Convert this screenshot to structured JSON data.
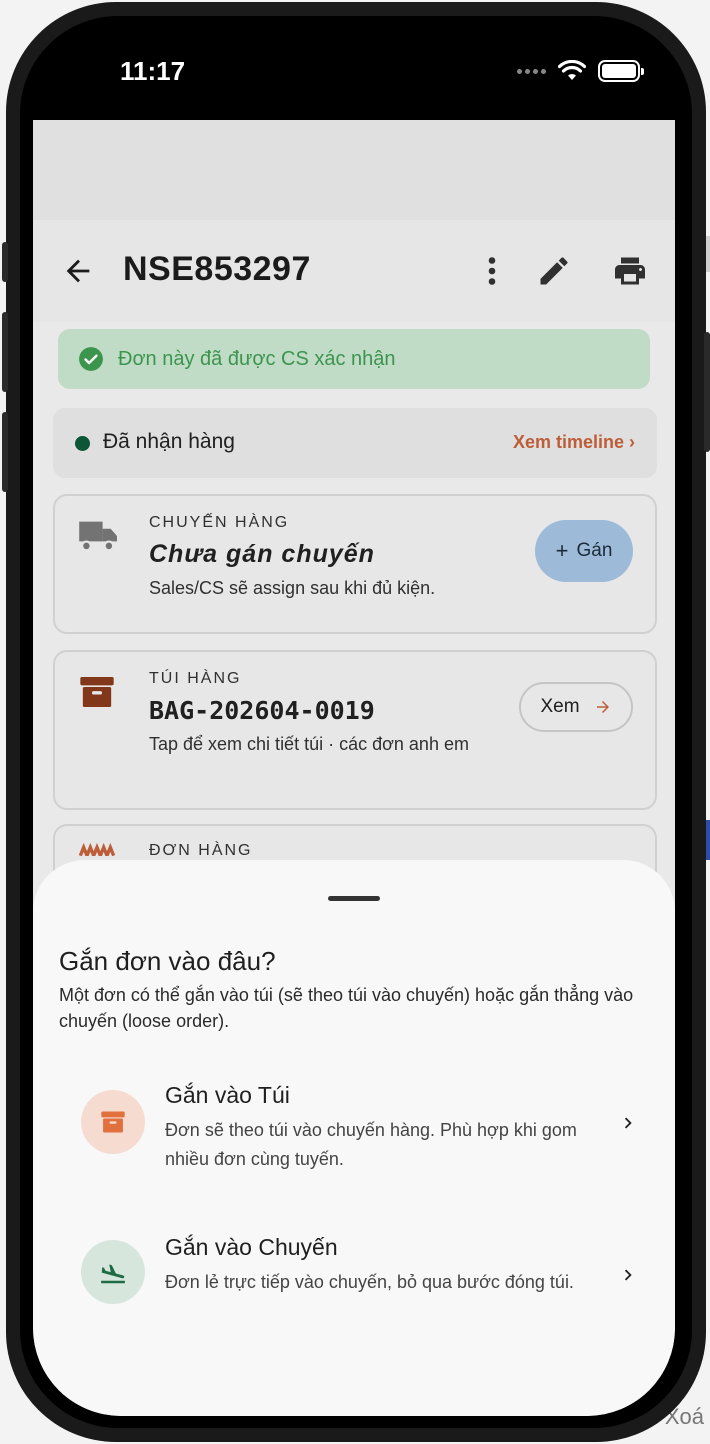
{
  "status_bar": {
    "time": "11:17"
  },
  "app_bar": {
    "order_code": "NSE853297"
  },
  "banner": {
    "text": "Đơn này đã được CS xác nhận"
  },
  "order_status": {
    "label": "Đã nhận hàng",
    "timeline_link": "Xem timeline ›"
  },
  "shipment_card": {
    "eyebrow": "CHUYẾN HÀNG",
    "value": "Chưa gán chuyến",
    "note": "Sales/CS sẽ assign sau khi đủ kiện.",
    "assign_label": "Gán",
    "assign_icon": "plus-icon"
  },
  "bag_card": {
    "eyebrow": "TÚI HÀNG",
    "value": "BAG-202604-0019",
    "note": "Tap để xem chi tiết túi · các đơn anh em",
    "view_label": "Xem"
  },
  "order_card_peek": {
    "eyebrow": "ĐƠN HÀNG"
  },
  "sheet": {
    "title": "Gắn đơn vào đâu?",
    "description": "Một đơn có thể gắn vào túi (sẽ theo túi vào chuyến) hoặc gắn thẳng vào chuyến (loose order).",
    "options": [
      {
        "title": "Gắn vào Túi",
        "description": "Đơn sẽ theo túi vào chuyến hàng. Phù hợp khi gom nhiều đơn cùng tuyến.",
        "icon": "archive-box-icon"
      },
      {
        "title": "Gắn vào Chuyến",
        "description": "Đơn lẻ trực tiếp vào chuyến, bỏ qua bước đóng túi.",
        "icon": "flight-land-icon"
      }
    ]
  },
  "backdrop": {
    "partial_text": "Xoá"
  },
  "colors": {
    "accent_orange": "#c8643d",
    "success_green": "#3f9d52",
    "success_bg": "#cbe8d1",
    "status_dot": "#0e5a3a",
    "assign_blue": "#a6c6e4",
    "bag_brown": "#8a3a1c"
  }
}
